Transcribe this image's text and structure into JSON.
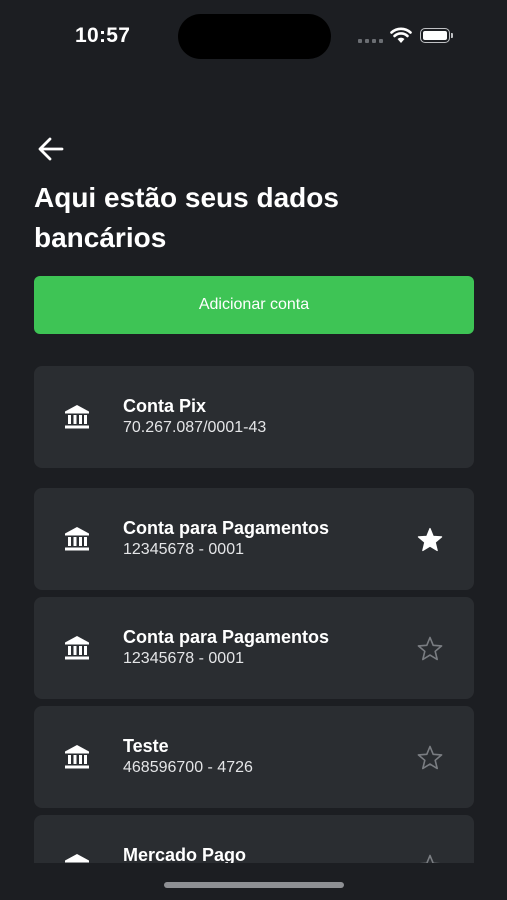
{
  "status_bar": {
    "time": "10:57"
  },
  "header": {
    "title": "Aqui estão seus dados bancários"
  },
  "actions": {
    "add_account_label": "Adicionar conta"
  },
  "accounts": [
    {
      "name": "Conta Pix",
      "detail": "70.267.087/0001-43",
      "favorite": null
    },
    {
      "name": "Conta para Pagamentos",
      "detail": "12345678 - 0001",
      "favorite": true
    },
    {
      "name": "Conta para Pagamentos",
      "detail": "12345678 - 0001",
      "favorite": false
    },
    {
      "name": "Teste",
      "detail": "468596700 - 4726",
      "favorite": false
    },
    {
      "name": "Mercado Pago",
      "detail": "",
      "favorite": false
    }
  ],
  "colors": {
    "background": "#1c1e22",
    "card": "#2a2d31",
    "accent": "#3ec455",
    "star_inactive": "#7a7d82"
  },
  "icons": {
    "back": "arrow-left-icon",
    "bank": "bank-icon",
    "favorite_on": "star-filled-icon",
    "favorite_off": "star-outline-icon"
  }
}
